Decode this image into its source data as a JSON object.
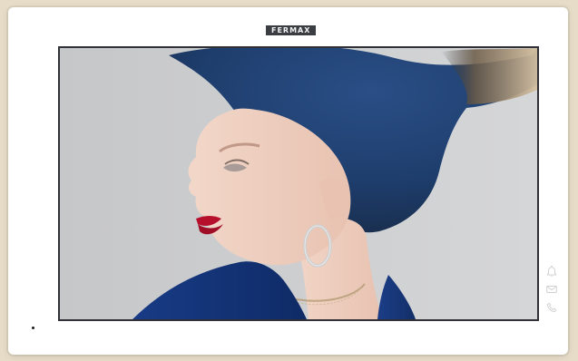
{
  "device": {
    "brand_logo_text": "FERMAX",
    "icons": {
      "bell": "bell-icon",
      "mail": "mail-icon",
      "phone": "phone-icon"
    },
    "colors": {
      "frame": "#ffffff",
      "logo_bg": "#3a3d42",
      "bezel": "#2f3136",
      "icon": "#cfcfcf"
    }
  }
}
